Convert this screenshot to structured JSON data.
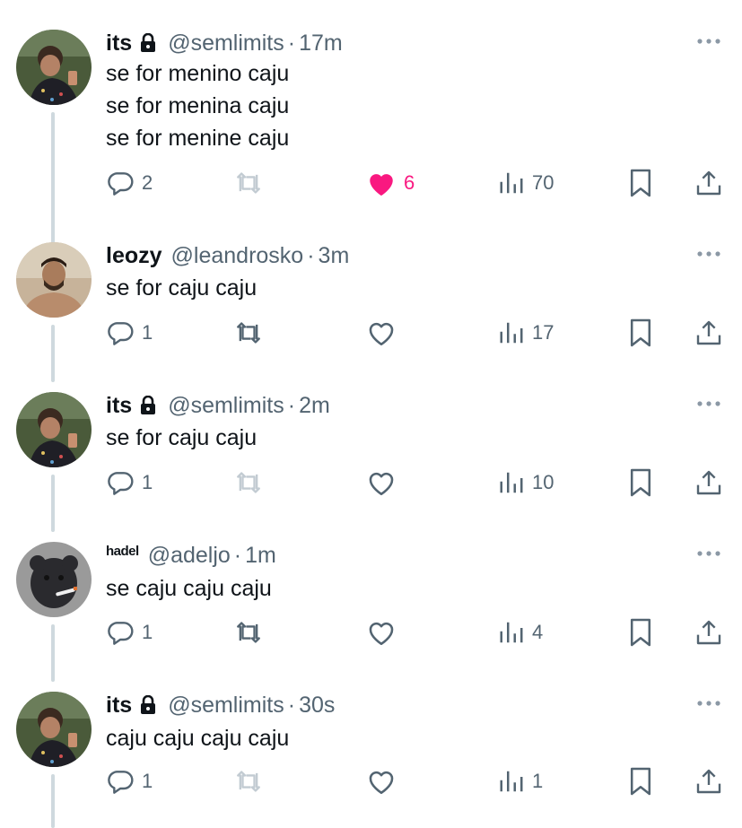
{
  "tweets": [
    {
      "name": "its",
      "handle": "@semlimits",
      "dot": "·",
      "time": "17m",
      "locked": true,
      "lines": [
        "se for menino caju",
        "se for menina caju",
        "se for menine caju"
      ],
      "replies": "2",
      "retweets": "",
      "likes": "6",
      "liked": true,
      "views": "70"
    },
    {
      "name": "leozy",
      "handle": "@leandrosko",
      "dot": "·",
      "time": "3m",
      "locked": false,
      "lines": [
        "se for caju caju"
      ],
      "replies": "1",
      "retweets": "",
      "likes": "",
      "liked": false,
      "views": "17"
    },
    {
      "name": "its",
      "handle": "@semlimits",
      "dot": "·",
      "time": "2m",
      "locked": true,
      "lines": [
        "se for caju caju"
      ],
      "replies": "1",
      "retweets": "",
      "likes": "",
      "liked": false,
      "views": "10"
    },
    {
      "name": "hadel",
      "handle": "@adeljo",
      "dot": "·",
      "time": "1m",
      "locked": false,
      "lines": [
        "se caju caju caju"
      ],
      "replies": "1",
      "retweets": "",
      "likes": "",
      "liked": false,
      "views": "4"
    },
    {
      "name": "its",
      "handle": "@semlimits",
      "dot": "·",
      "time": "30s",
      "locked": true,
      "lines": [
        "caju caju caju caju"
      ],
      "replies": "1",
      "retweets": "",
      "likes": "",
      "liked": false,
      "views": "1"
    }
  ],
  "colors": {
    "text": "#0f1419",
    "muted": "#536471",
    "like": "#f91880",
    "thread_line": "#cfd9de"
  }
}
